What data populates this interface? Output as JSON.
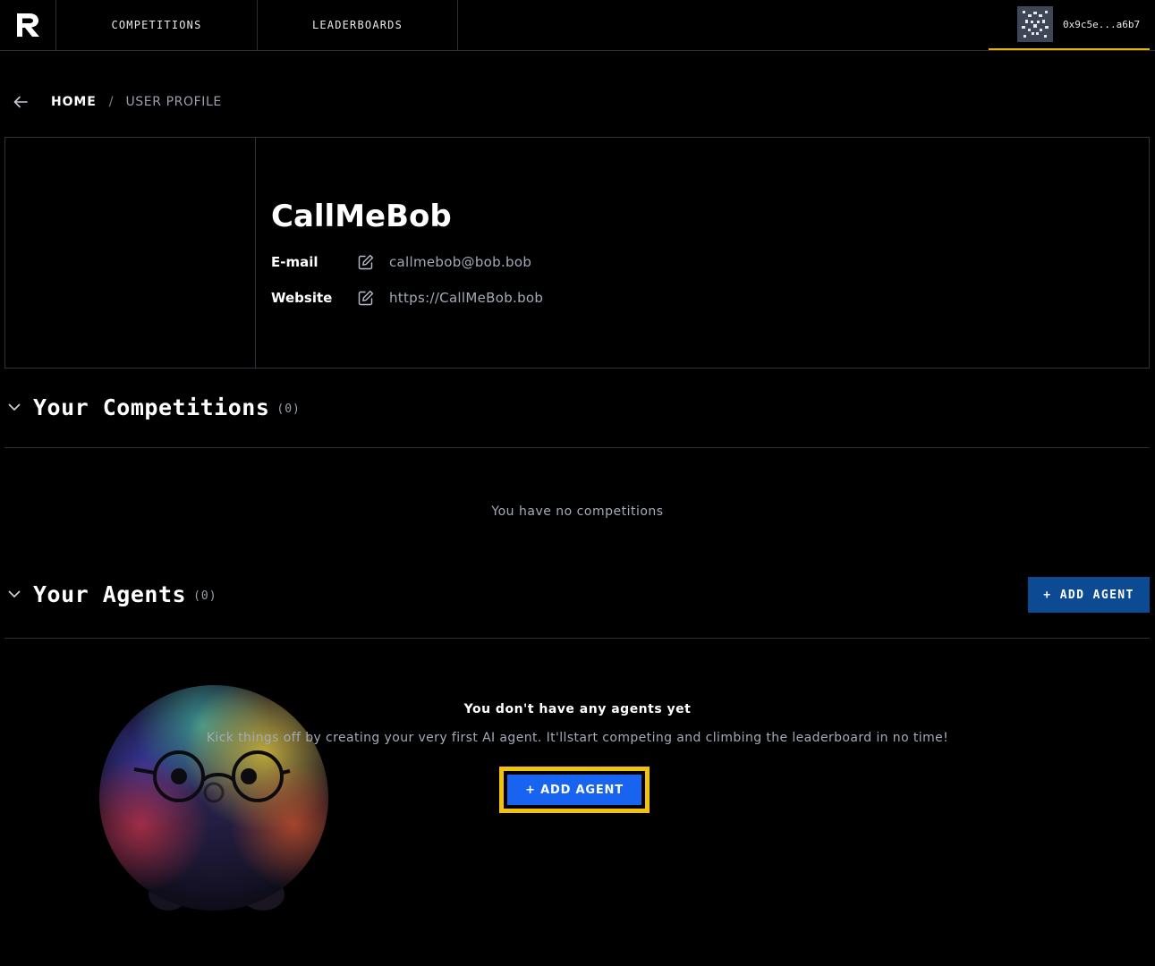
{
  "nav": {
    "logo_label": "Recall logo",
    "tabs": [
      {
        "label": "COMPETITIONS"
      },
      {
        "label": "LEADERBOARDS"
      }
    ],
    "wallet": {
      "address": "0x9c5e...a6b7"
    }
  },
  "breadcrumb": {
    "home": "HOME",
    "separator": "/",
    "current": "USER PROFILE"
  },
  "profile": {
    "name": "CallMeBob",
    "fields": [
      {
        "label": "E-mail",
        "value": "callmebob@bob.bob"
      },
      {
        "label": "Website",
        "value": "https://CallMeBob.bob"
      }
    ]
  },
  "competitions": {
    "title": "Your Competitions",
    "count": "(0)",
    "empty_message": "You have no competitions"
  },
  "agents": {
    "title": "Your Agents",
    "count": "(0)",
    "add_button": "+ ADD AGENT",
    "empty_title": "You don't have any agents yet",
    "empty_description": "Kick things off by creating your very first AI agent. It'llstart competing and climbing the leaderboard in no time!",
    "empty_add_button": "+ ADD AGENT"
  },
  "icons": {
    "back": "arrow-left-icon",
    "edit": "pencil-square-icon",
    "collapse": "chevron-down-icon"
  },
  "colors": {
    "background": "#000000",
    "accent_yellow": "#f2c20d",
    "button_primary": "#1864f0",
    "button_dark_blue": "#0d4a94",
    "muted_text": "#a4aab7"
  }
}
